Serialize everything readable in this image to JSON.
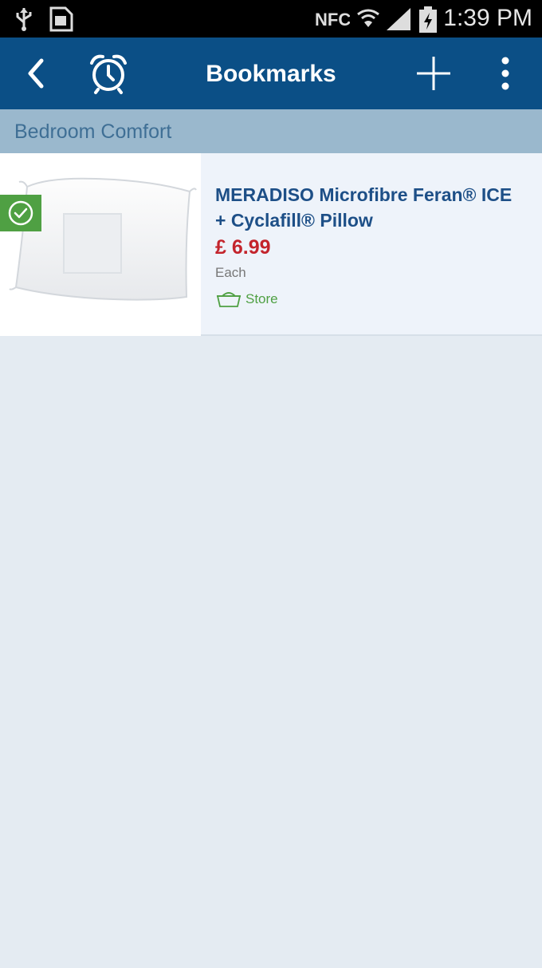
{
  "status_bar": {
    "time": "1:39 PM",
    "icons": [
      "usb-icon",
      "image-icon",
      "nfc-icon",
      "wifi-icon",
      "signal-icon",
      "battery-icon"
    ]
  },
  "app_bar": {
    "title": "Bookmarks",
    "icons": [
      "back-arrow-icon",
      "alarm-clock-icon",
      "plus-icon",
      "overflow-menu-icon"
    ]
  },
  "section": {
    "title": "Bedroom Comfort"
  },
  "items": [
    {
      "title": "MERADISO Microfibre Feran® ICE + Cyclafill® Pillow",
      "price": "£ 6.99",
      "unit": "Each",
      "availability": "Store",
      "checked": true
    }
  ],
  "colors": {
    "app_bar": "#0b4f86",
    "section_header": "#9ab8cd",
    "price": "#c3242c",
    "check_badge": "#4fa043",
    "background": "#e4ebf2"
  }
}
